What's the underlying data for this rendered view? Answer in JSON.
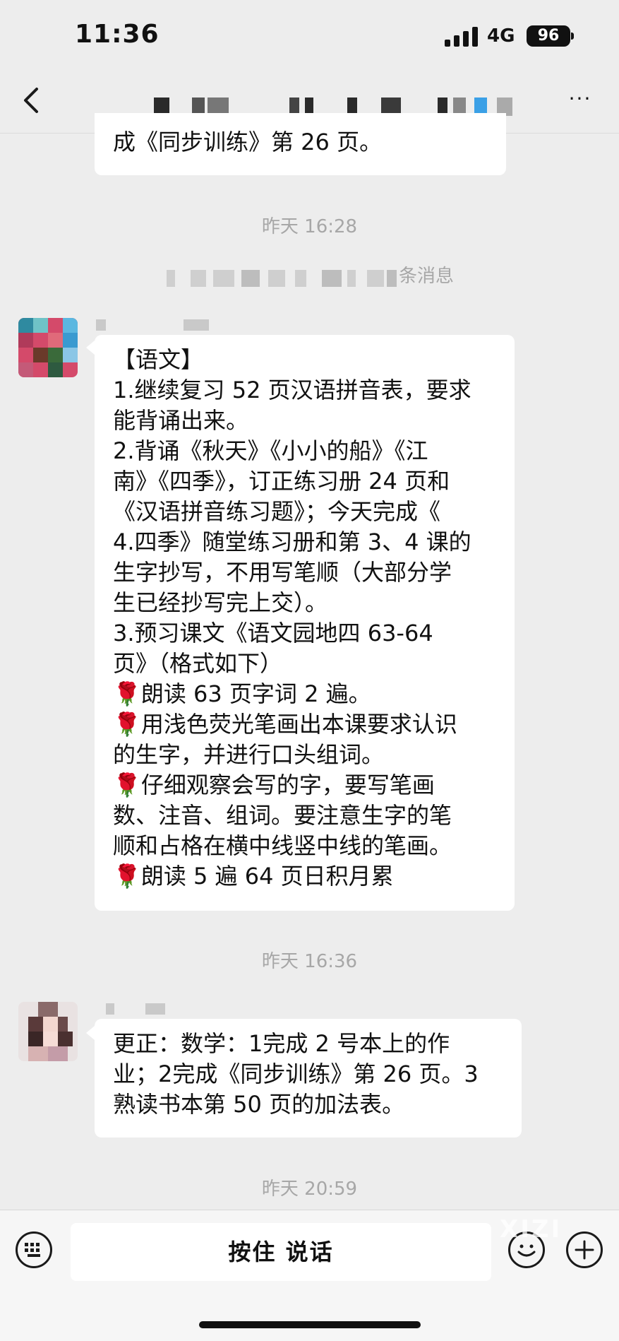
{
  "status_bar": {
    "time": "11:36",
    "network": "4G",
    "battery": "96"
  },
  "nav": {
    "back_icon": "chevron-left-icon",
    "more_label": "···"
  },
  "messages": {
    "top_partial": "成《同步训练》第 26 页。",
    "ts1": "昨天 16:28",
    "system_suffix": "条消息",
    "yuwen_lines": [
      "【语文】",
      "1.继续复习 52 页汉语拼音表，要求",
      "能背诵出来。",
      "2.背诵《秋天》《小小的船》《江",
      "南》《四季》，订正练习册 24 页和",
      "《汉语拼音练习题》；今天完成《",
      "4.四季》随堂练习册和第 3、4 课的",
      "生字抄写，不用写笔顺（大部分学",
      "生已经抄写完上交）。",
      "3.预习课文《语文园地四 63-64",
      "页》（格式如下）",
      "🌹朗读 63 页字词 2 遍。",
      "🌹用浅色荧光笔画出本课要求认识",
      "的生字，并进行口头组词。",
      "🌹仔细观察会写的字，要写笔画",
      "数、注音、组词。要注意生字的笔",
      "顺和占格在横中线竖中线的笔画。",
      "🌹朗读 5 遍 64 页日积月累"
    ],
    "ts2": "昨天 16:36",
    "correction_lines": [
      "更正：数学：1完成 2 号本上的作",
      "业；2完成《同步训练》第 26 页。3",
      "熟读书本第 50 页的加法表。"
    ],
    "ts3": "昨天 20:59"
  },
  "input_bar": {
    "voice_keyboard_icon": "keyboard-icon",
    "hold_to_talk": "按住 说话",
    "emoji_icon": "smile-icon",
    "plus_icon": "plus-icon"
  },
  "watermark": "XIZI",
  "colors": {
    "background": "#ededed",
    "bubble": "#ffffff",
    "timestamp": "#a7a7a7"
  }
}
